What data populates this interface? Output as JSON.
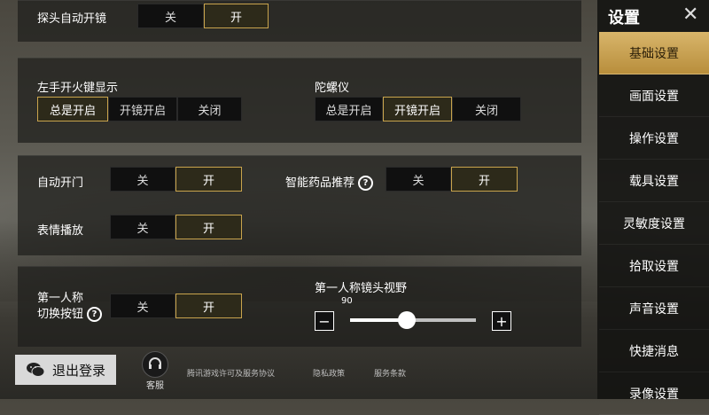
{
  "top": {
    "camera_auto_scope": {
      "label": "探头自动开镜",
      "options": [
        "关",
        "开"
      ],
      "selected": 1
    }
  },
  "fire_panel": {
    "left_fire": {
      "label": "左手开火键显示",
      "options": [
        "总是开启",
        "开镜开启",
        "关闭"
      ],
      "selected": 0
    },
    "gyro": {
      "label": "陀螺仪",
      "options": [
        "总是开启",
        "开镜开启",
        "关闭"
      ],
      "selected": 1
    }
  },
  "misc_panel": {
    "auto_door": {
      "label": "自动开门",
      "options": [
        "关",
        "开"
      ],
      "selected": 1
    },
    "smart_medicine": {
      "label": "智能药品推荐",
      "options": [
        "关",
        "开"
      ],
      "selected": 1
    },
    "emote": {
      "label": "表情播放",
      "options": [
        "关",
        "开"
      ],
      "selected": 1
    }
  },
  "fpp_panel": {
    "switch_btn": {
      "label_line1": "第一人称",
      "label_line2": "切换按钮",
      "options": [
        "关",
        "开"
      ],
      "selected": 1
    },
    "fov": {
      "label": "第一人称镜头视野",
      "value": "90",
      "fraction": 0.45,
      "minus": "−",
      "plus": "+"
    }
  },
  "sidebar": {
    "title": "设置",
    "close": "✕",
    "items": [
      "基础设置",
      "画面设置",
      "操作设置",
      "载具设置",
      "灵敏度设置",
      "拾取设置",
      "声音设置",
      "快捷消息",
      "录像设置"
    ],
    "active": 0
  },
  "footer": {
    "logout": "退出登录",
    "service": "客服",
    "links": [
      "腾讯游戏许可及服务协议",
      "隐私政策",
      "服务条款"
    ]
  },
  "help_icon": "?",
  "colors": {
    "accent": "#c9a44d",
    "active_tab": "#d0aa56"
  }
}
